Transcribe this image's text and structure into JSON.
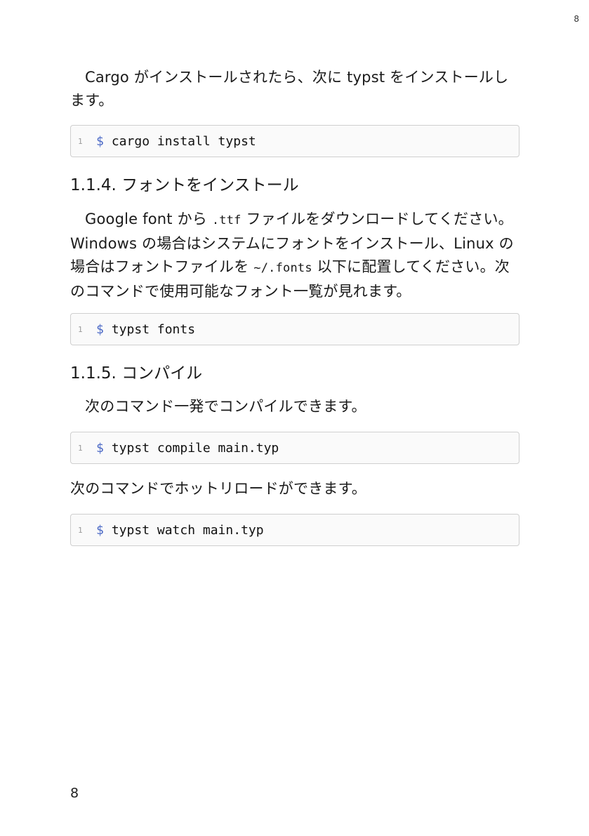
{
  "page": {
    "number_top": "8",
    "number_bottom": "8"
  },
  "paragraph1": {
    "text": "Cargo がインストールされたら、次に typst をインストールします。"
  },
  "code1": {
    "line": "1",
    "prompt": "$",
    "command": "cargo install typst"
  },
  "section_fonts": {
    "heading": "1.1.4. フォントをインストール",
    "p_a": "Google font から ",
    "p_code1": ".ttf",
    "p_b": " ファイルをダウンロードしてください。Windows の場合はシステムにフォントをインストール、Linux の場合はフォントファイルを ",
    "p_code2": "~/.fonts",
    "p_c": " 以下に配置してください。次のコマンドで使用可能なフォント一覧が見れます。"
  },
  "code2": {
    "line": "1",
    "prompt": "$",
    "command": "typst fonts"
  },
  "section_compile": {
    "heading": "1.1.5. コンパイル",
    "paragraph": "次のコマンド一発でコンパイルできます。"
  },
  "code3": {
    "line": "1",
    "prompt": "$",
    "command": "typst compile main.typ"
  },
  "paragraph_hotreload": {
    "text": "次のコマンドでホットリロードができます。"
  },
  "code4": {
    "line": "1",
    "prompt": "$",
    "command": "typst watch main.typ"
  }
}
